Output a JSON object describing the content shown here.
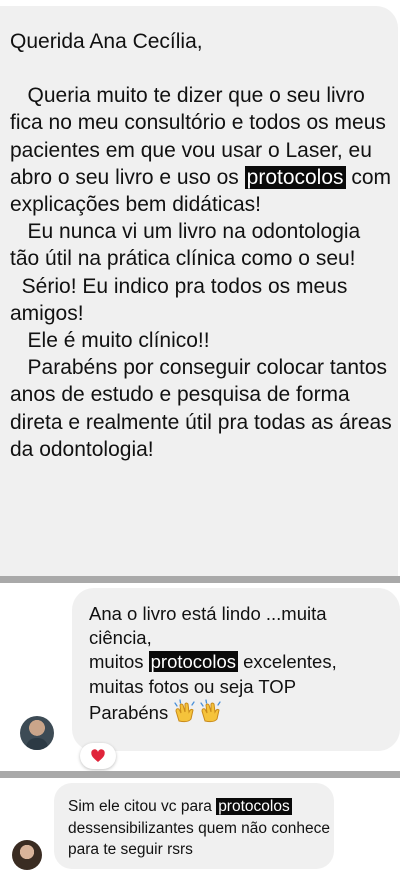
{
  "message1": {
    "greeting": "Querida Ana Cecília,",
    "para1_before": "   Queria muito te dizer que o seu livro fica no meu consultório e todos os meus pacientes em que vou usar o Laser, eu abro o seu livro e uso os ",
    "highlight": "protocolos",
    "para1_after": " com explicações bem didáticas!",
    "para2": "   Eu nunca vi um livro na odontologia tão útil na prática clínica como o seu!",
    "para3": "  Sério! Eu indico pra todos os meus amigos!",
    "para4": "   Ele é muito clínico!!",
    "para5": "   Parabéns por conseguir colocar tantos anos de estudo e pesquisa de forma direta e realmente útil pra todas as áreas da odontologia!"
  },
  "message2": {
    "line1": "Ana o livro está lindo ...muita ciência,",
    "line2_before": "muitos ",
    "highlight": "protocolos",
    "line2_after": " excelentes, muitas fotos ou seja TOP",
    "line3": "Parabéns ",
    "reaction_icon": "heart-icon",
    "reaction_color": "#e0243a",
    "emoji_icon": "clapping-hands-icon"
  },
  "message3": {
    "before": "Sim ele citou vc para ",
    "highlight": "protocolos",
    "after": " dessensibilizantes quem não conhece para te seguir rsrs"
  },
  "colors": {
    "bubble": "#f0f0f0",
    "divider": "#a9a9a9",
    "highlight_bg": "#0a0a0a"
  }
}
